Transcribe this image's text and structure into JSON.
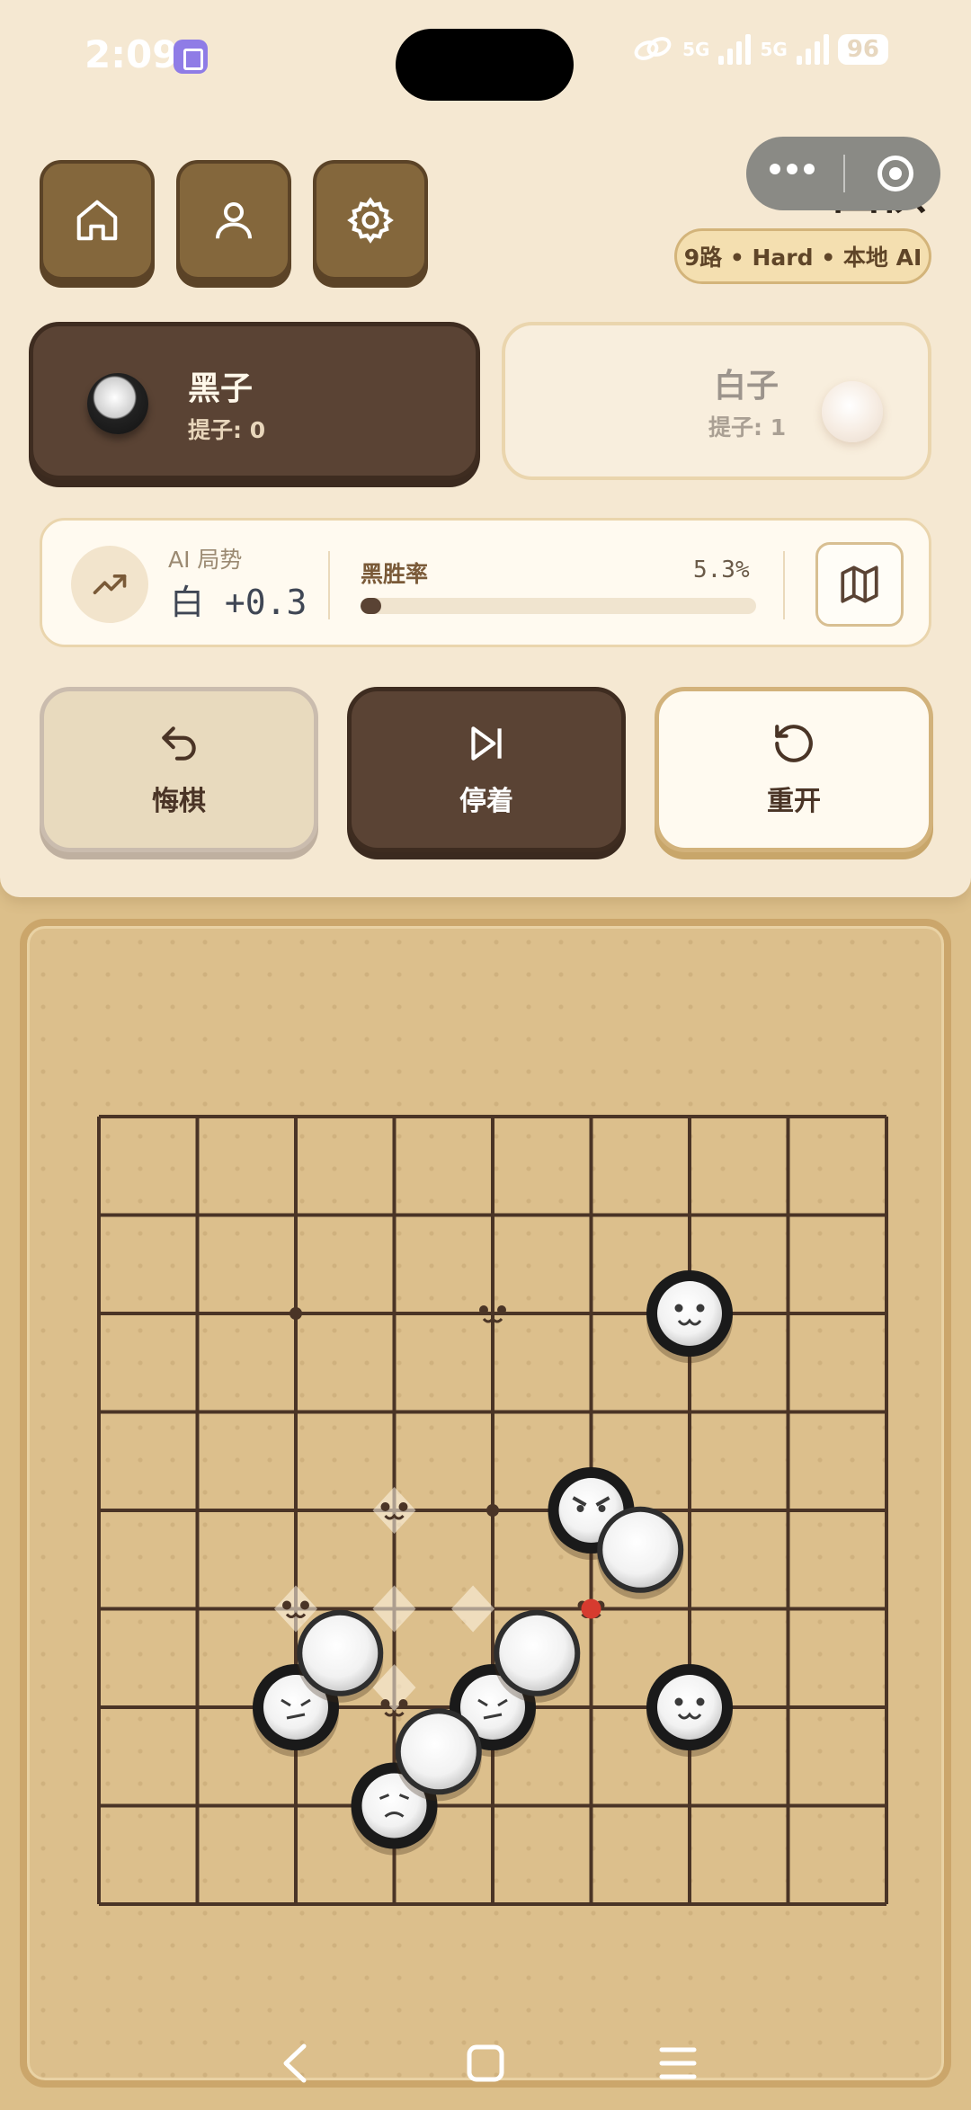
{
  "status_bar": {
    "time": "2:09",
    "network_1": "5G",
    "network_2": "5G",
    "battery": "96"
  },
  "header": {
    "app_title": "围棋",
    "game_mode": "9路 • Hard • 本地 AI",
    "nav_buttons": [
      {
        "icon": "home-icon"
      },
      {
        "icon": "user-icon"
      },
      {
        "icon": "gear-icon"
      }
    ]
  },
  "players": {
    "black": {
      "name": "黑子",
      "captures": "提子: 0",
      "active": true
    },
    "white": {
      "name": "白子",
      "captures": "提子: 1",
      "active": false
    }
  },
  "ai_status": {
    "label": "AI 局势",
    "score": "白 +0.3",
    "winrate_label": "黑胜率",
    "winrate_value": "5.3%",
    "winrate_fraction": 0.053,
    "map_icon": "map-icon"
  },
  "actions": [
    {
      "label": "悔棋",
      "icon": "undo-icon"
    },
    {
      "label": "停着",
      "icon": "pass-icon"
    },
    {
      "label": "重开",
      "icon": "restart-icon"
    }
  ],
  "board": {
    "size": 9,
    "colors": {
      "line": "#4a3426",
      "black_stone": "#1a1a1a",
      "white_stone": "#ffffff",
      "last_move": "#d63b2f"
    },
    "stones": [
      {
        "col": 6,
        "row": 2,
        "color": "black",
        "face": "smile"
      },
      {
        "col": 5,
        "row": 4,
        "color": "black",
        "face": "angry"
      },
      {
        "col": 5.5,
        "row": 4.4,
        "color": "white",
        "face": "none"
      },
      {
        "col": 2,
        "row": 6,
        "color": "black",
        "face": "hurt"
      },
      {
        "col": 2.45,
        "row": 5.45,
        "color": "white",
        "face": "none"
      },
      {
        "col": 4,
        "row": 6,
        "color": "black",
        "face": "hurt"
      },
      {
        "col": 4.45,
        "row": 5.45,
        "color": "white",
        "face": "none"
      },
      {
        "col": 6,
        "row": 6,
        "color": "black",
        "face": "smile"
      },
      {
        "col": 3,
        "row": 7,
        "color": "black",
        "face": "sad"
      },
      {
        "col": 3.45,
        "row": 6.45,
        "color": "white",
        "face": "none"
      }
    ],
    "hoshi": [
      [
        2,
        2
      ],
      [
        4,
        4
      ],
      [
        6,
        6
      ],
      [
        2,
        6
      ],
      [
        6,
        2
      ]
    ],
    "ghost_marks": [
      [
        3,
        4
      ],
      [
        2,
        5
      ],
      [
        3,
        5
      ],
      [
        3.8,
        5
      ],
      [
        3,
        5.8
      ]
    ],
    "small_faces": [
      [
        4,
        2
      ],
      [
        3,
        4
      ],
      [
        2,
        5
      ],
      [
        3,
        6
      ],
      [
        5,
        5
      ]
    ],
    "last_move": [
      5,
      5
    ]
  },
  "navbar": {
    "icons": [
      "back-icon",
      "home-square-icon",
      "menu-icon"
    ]
  }
}
